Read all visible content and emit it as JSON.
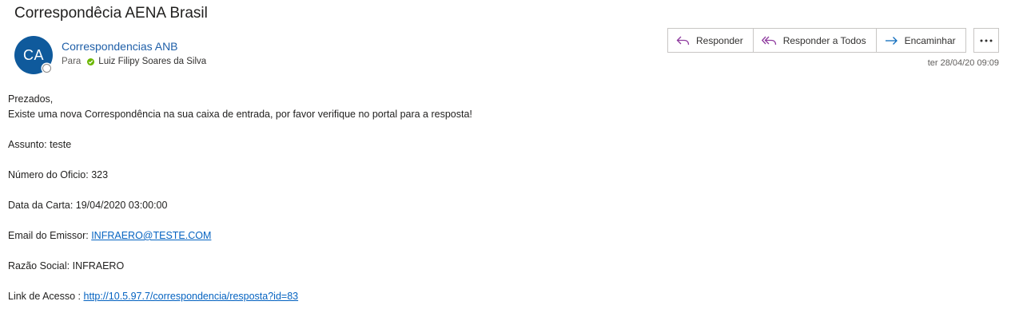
{
  "email": {
    "subject": "Correspondêcia AENA Brasil",
    "avatar_initials": "CA",
    "sender_name": "Correspondencias ANB",
    "to_label": "Para",
    "recipient": "Luiz Filipy Soares da Silva",
    "timestamp": "ter 28/04/20 09:09"
  },
  "actions": {
    "reply": "Responder",
    "reply_all": "Responder a Todos",
    "forward": "Encaminhar",
    "more_icon": "more-icon"
  },
  "body": {
    "greeting": "Prezados,",
    "intro": "Existe uma nova Correspondência na sua caixa de entrada, por favor verifique no portal para a resposta!",
    "assunto": "Assunto: teste",
    "numero_oficio": "Número do Oficio: 323",
    "data_carta": "Data da Carta: 19/04/2020 03:00:00",
    "email_label": "Email do Emissor: ",
    "email_value": "INFRAERO@TESTE.COM",
    "razao_social": "Razão Social: INFRAERO",
    "link_label": "Link de Acesso : ",
    "link_value": "http://10.5.97.7/correspondencia/resposta?id=83"
  },
  "colors": {
    "avatar_bg": "#0f5a9c",
    "sender_link": "#1f5fa8",
    "hyperlink": "#0563c1",
    "reply_icon": "#8e3a9e",
    "forward_icon": "#0f6cbd",
    "presence_ok": "#6bb700"
  }
}
